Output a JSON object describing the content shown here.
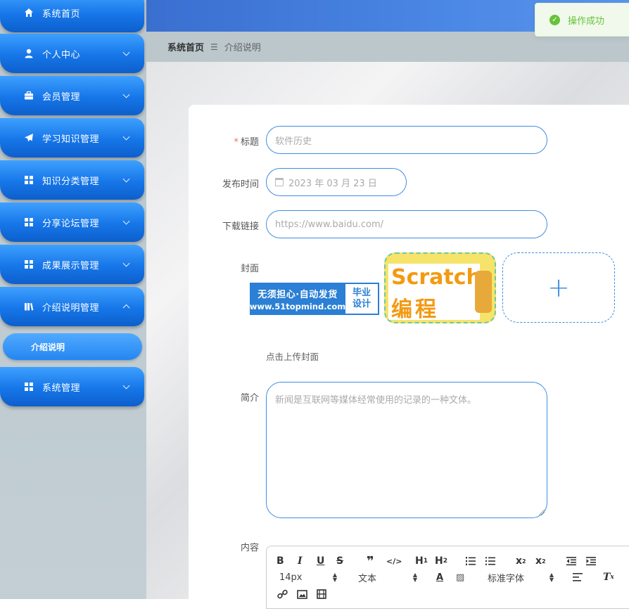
{
  "sidebar": {
    "items": [
      {
        "label": "系统首页",
        "icon": "home-icon",
        "expandable": false
      },
      {
        "label": "个人中心",
        "icon": "user-icon",
        "expandable": true
      },
      {
        "label": "会员管理",
        "icon": "briefcase-icon",
        "expandable": true
      },
      {
        "label": "学习知识管理",
        "icon": "paper-plane-icon",
        "expandable": true
      },
      {
        "label": "知识分类管理",
        "icon": "grid-icon",
        "expandable": true
      },
      {
        "label": "分享论坛管理",
        "icon": "grid-icon",
        "expandable": true
      },
      {
        "label": "成果展示管理",
        "icon": "grid-icon",
        "expandable": true
      },
      {
        "label": "介绍说明管理",
        "icon": "book-icon",
        "expandable": true,
        "expanded": true
      },
      {
        "label": "系统管理",
        "icon": "grid-icon",
        "expandable": true
      }
    ],
    "submenu": {
      "label": "介绍说明"
    }
  },
  "breadcrumb": {
    "home": "系统首页",
    "separator": "☰",
    "current": "介绍说明"
  },
  "toast": {
    "text": "操作成功",
    "type": "success"
  },
  "form": {
    "title": {
      "label": "标题",
      "required": true,
      "value": "软件历史"
    },
    "publish_time": {
      "label": "发布时间",
      "value": "2023 年 03 月 23 日"
    },
    "download_link": {
      "label": "下载链接",
      "value": "https://www.baidu.com/"
    },
    "cover": {
      "label": "封面",
      "hint": "点击上传封面",
      "logo_line1": "无须担心·自动发货",
      "logo_line2": "www.51topmind.com",
      "logo_side1": "毕业",
      "logo_side2": "设计",
      "scratch_word": "Scratch",
      "scratch_cn": "编程"
    },
    "summary": {
      "label": "简介",
      "value": "新闻是互联网等媒体经常使用的记录的一种文体。"
    },
    "content": {
      "label": "内容"
    }
  },
  "editor": {
    "font_size": "14px",
    "header_type": "文本",
    "font_family": "标准字体"
  },
  "colors": {
    "accent": "#1676e8",
    "input_border": "#3f8ee0",
    "success": "#67c23a",
    "required": "#f56c6c"
  }
}
